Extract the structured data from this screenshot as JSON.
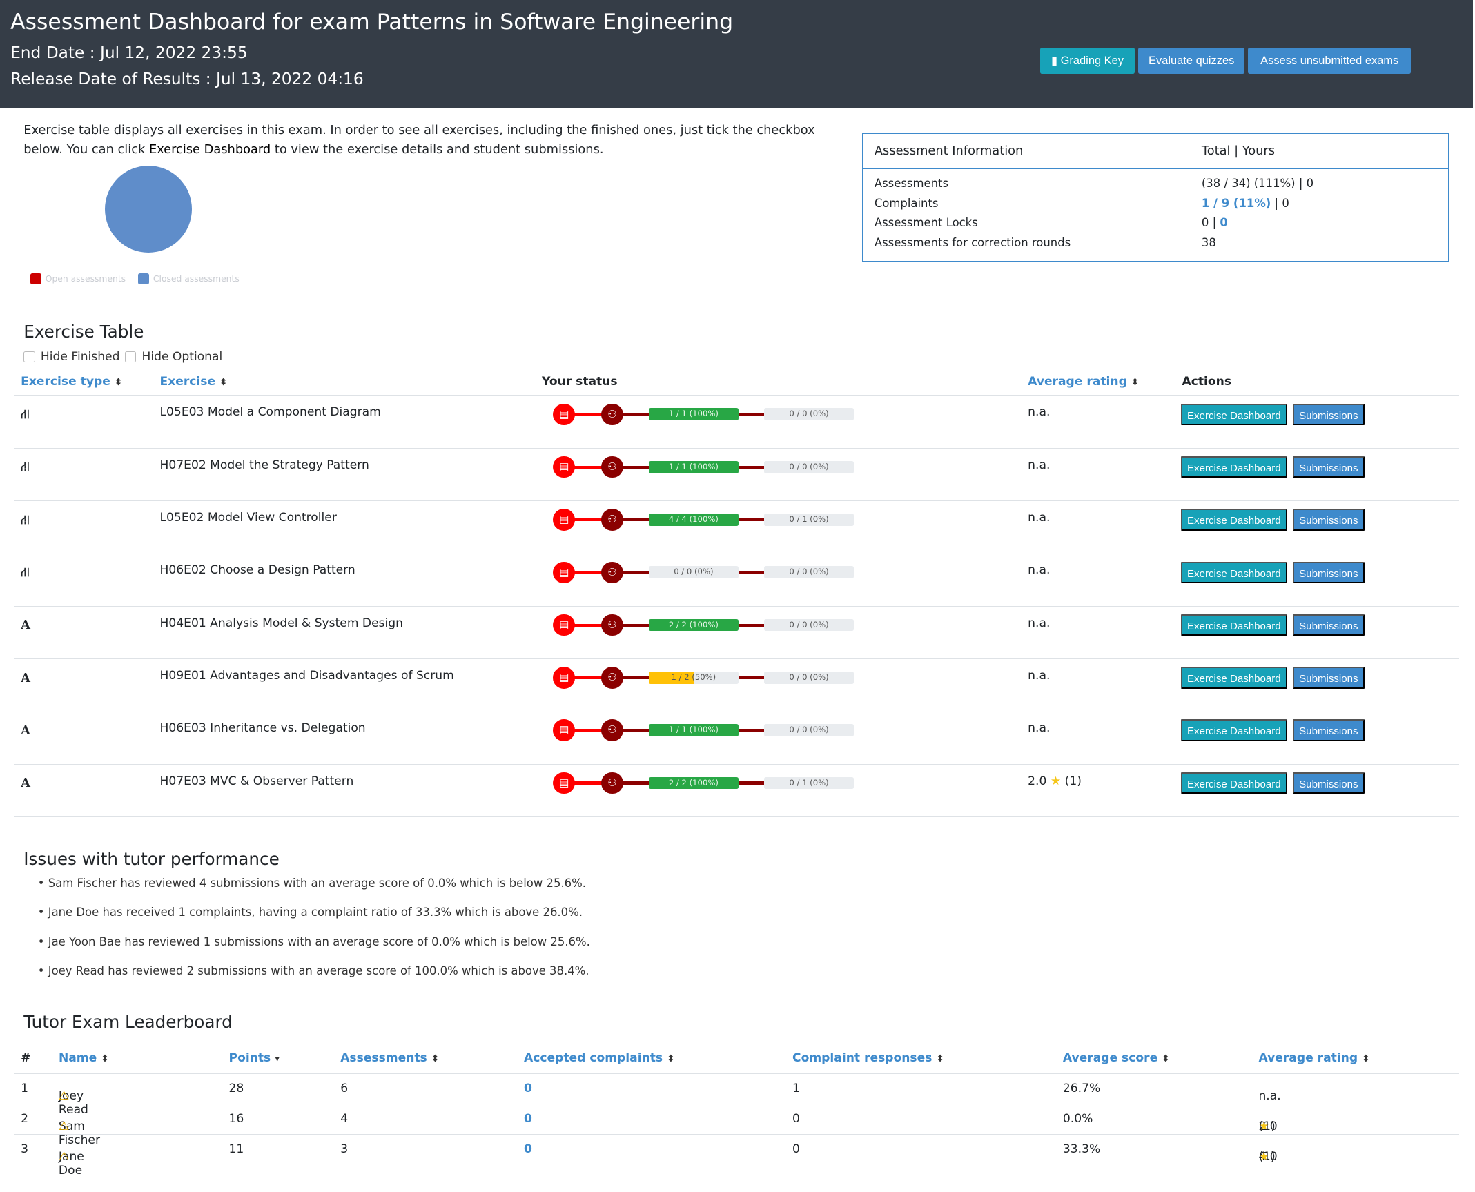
{
  "header": {
    "title": "Assessment Dashboard for exam Patterns in Software Engineering",
    "end_date": "End Date : Jul 12, 2022 23:55",
    "release_date": "Release Date of Results : Jul 13, 2022 04:16",
    "buttons": {
      "grading_key": "Grading Key",
      "evaluate_quizzes": "Evaluate quizzes",
      "assess_unsubmitted": "Assess unsubmitted exams"
    }
  },
  "intro": {
    "text_before": "Exercise table displays all exercises in this exam. In order to see all exercises, including the finished ones, just tick the checkbox below. You can click ",
    "bold": "Exercise Dashboard",
    "text_after": " to view the exercise details and student submissions."
  },
  "pie": {
    "legend": [
      "Open assessments",
      "Closed assessments"
    ],
    "colors": [
      "#cc0000",
      "#5f8dca"
    ],
    "open": 0,
    "closed": 38
  },
  "info": {
    "header": "Assessment Information",
    "header_values": "Total | Yours",
    "rows": [
      {
        "label": "Assessments",
        "total": "(38 / 34) (111%)",
        "yours": "0"
      },
      {
        "label": "Complaints",
        "total": "1 / 9 (11%)",
        "yours": "0"
      },
      {
        "label": "Assessment Locks",
        "total": "0",
        "yours": "0"
      },
      {
        "label": "Assessments for correction rounds",
        "total": "38",
        "yours": ""
      }
    ]
  },
  "exercise_table": {
    "title": "Exercise Table",
    "hide_finished": "Hide Finished",
    "hide_optional": "Hide Optional",
    "columns": {
      "type": "Exercise type",
      "exercise": "Exercise",
      "status": "Your status",
      "rating": "Average rating",
      "actions": "Actions"
    },
    "dashboard_label": "Exercise Dashboard",
    "submissions_label": "Submissions",
    "rows": [
      {
        "type": "modeling",
        "name": "L05E03 Model a Component Diagram",
        "round1": "1 / 1 (100%)",
        "round1_pct": 100,
        "round2": "0 / 0 (0%)",
        "rating": "n.a."
      },
      {
        "type": "modeling",
        "name": "H07E02 Model the Strategy Pattern",
        "round1": "1 / 1 (100%)",
        "round1_pct": 100,
        "round2": "0 / 0 (0%)",
        "rating": "n.a."
      },
      {
        "type": "modeling",
        "name": "L05E02 Model View Controller",
        "round1": "4 / 4 (100%)",
        "round1_pct": 100,
        "round2": "0 / 1 (0%)",
        "rating": "n.a."
      },
      {
        "type": "modeling",
        "name": "H06E02 Choose a Design Pattern",
        "round1": "0 / 0 (0%)",
        "round1_pct": 0,
        "round2": "0 / 0 (0%)",
        "rating": "n.a."
      },
      {
        "type": "text",
        "name": "H04E01 Analysis Model & System Design",
        "round1": "2 / 2 (100%)",
        "round1_pct": 100,
        "round2": "0 / 0 (0%)",
        "rating": "n.a."
      },
      {
        "type": "text",
        "name": "H09E01 Advantages and Disadvantages of Scrum",
        "round1": "1 / 2 (50%)",
        "round1_pct": 50,
        "round2": "0 / 0 (0%)",
        "rating": "n.a."
      },
      {
        "type": "text",
        "name": "H06E03 Inheritance vs. Delegation",
        "round1": "1 / 1 (100%)",
        "round1_pct": 100,
        "round2": "0 / 0 (0%)",
        "rating": "n.a."
      },
      {
        "type": "text",
        "name": "H07E03 MVC & Observer Pattern",
        "round1": "2 / 2 (100%)",
        "round1_pct": 100,
        "round2": "0 / 1 (0%)",
        "rating": "2.0",
        "rating_count": "(1)"
      }
    ]
  },
  "issues": {
    "title": "Issues with tutor performance",
    "items": [
      "Sam Fischer has reviewed 4 submissions with an average score of 0.0% which is below 25.6%.",
      "Jane Doe has received 1 complaints, having a complaint ratio of 33.3% which is above 26.0%.",
      "Jae Yoon Bae has reviewed 1 submissions with an average score of 0.0% which is below 25.6%.",
      "Joey Read has reviewed 2 submissions with an average score of 100.0% which is above 38.4%."
    ]
  },
  "leaderboard": {
    "title": "Tutor Exam Leaderboard",
    "columns": [
      "#",
      "Name",
      "Points",
      "Assessments",
      "Accepted complaints",
      "Complaint responses",
      "Average score",
      "Average rating"
    ],
    "rows": [
      {
        "rank": "1",
        "name": "Joey Read",
        "points": "28",
        "assessments": "6",
        "accepted": "0",
        "responses": "1",
        "score": "26.7%",
        "rating": "n.a.",
        "rating_count": ""
      },
      {
        "rank": "2",
        "name": "Sam Fischer",
        "points": "16",
        "assessments": "4",
        "accepted": "0",
        "responses": "0",
        "score": "0.0%",
        "rating": "2.0",
        "rating_count": "(1)"
      },
      {
        "rank": "3",
        "name": "Jane Doe",
        "points": "11",
        "assessments": "3",
        "accepted": "0",
        "responses": "0",
        "score": "33.3%",
        "rating": "4.0",
        "rating_count": "(1)"
      }
    ]
  }
}
